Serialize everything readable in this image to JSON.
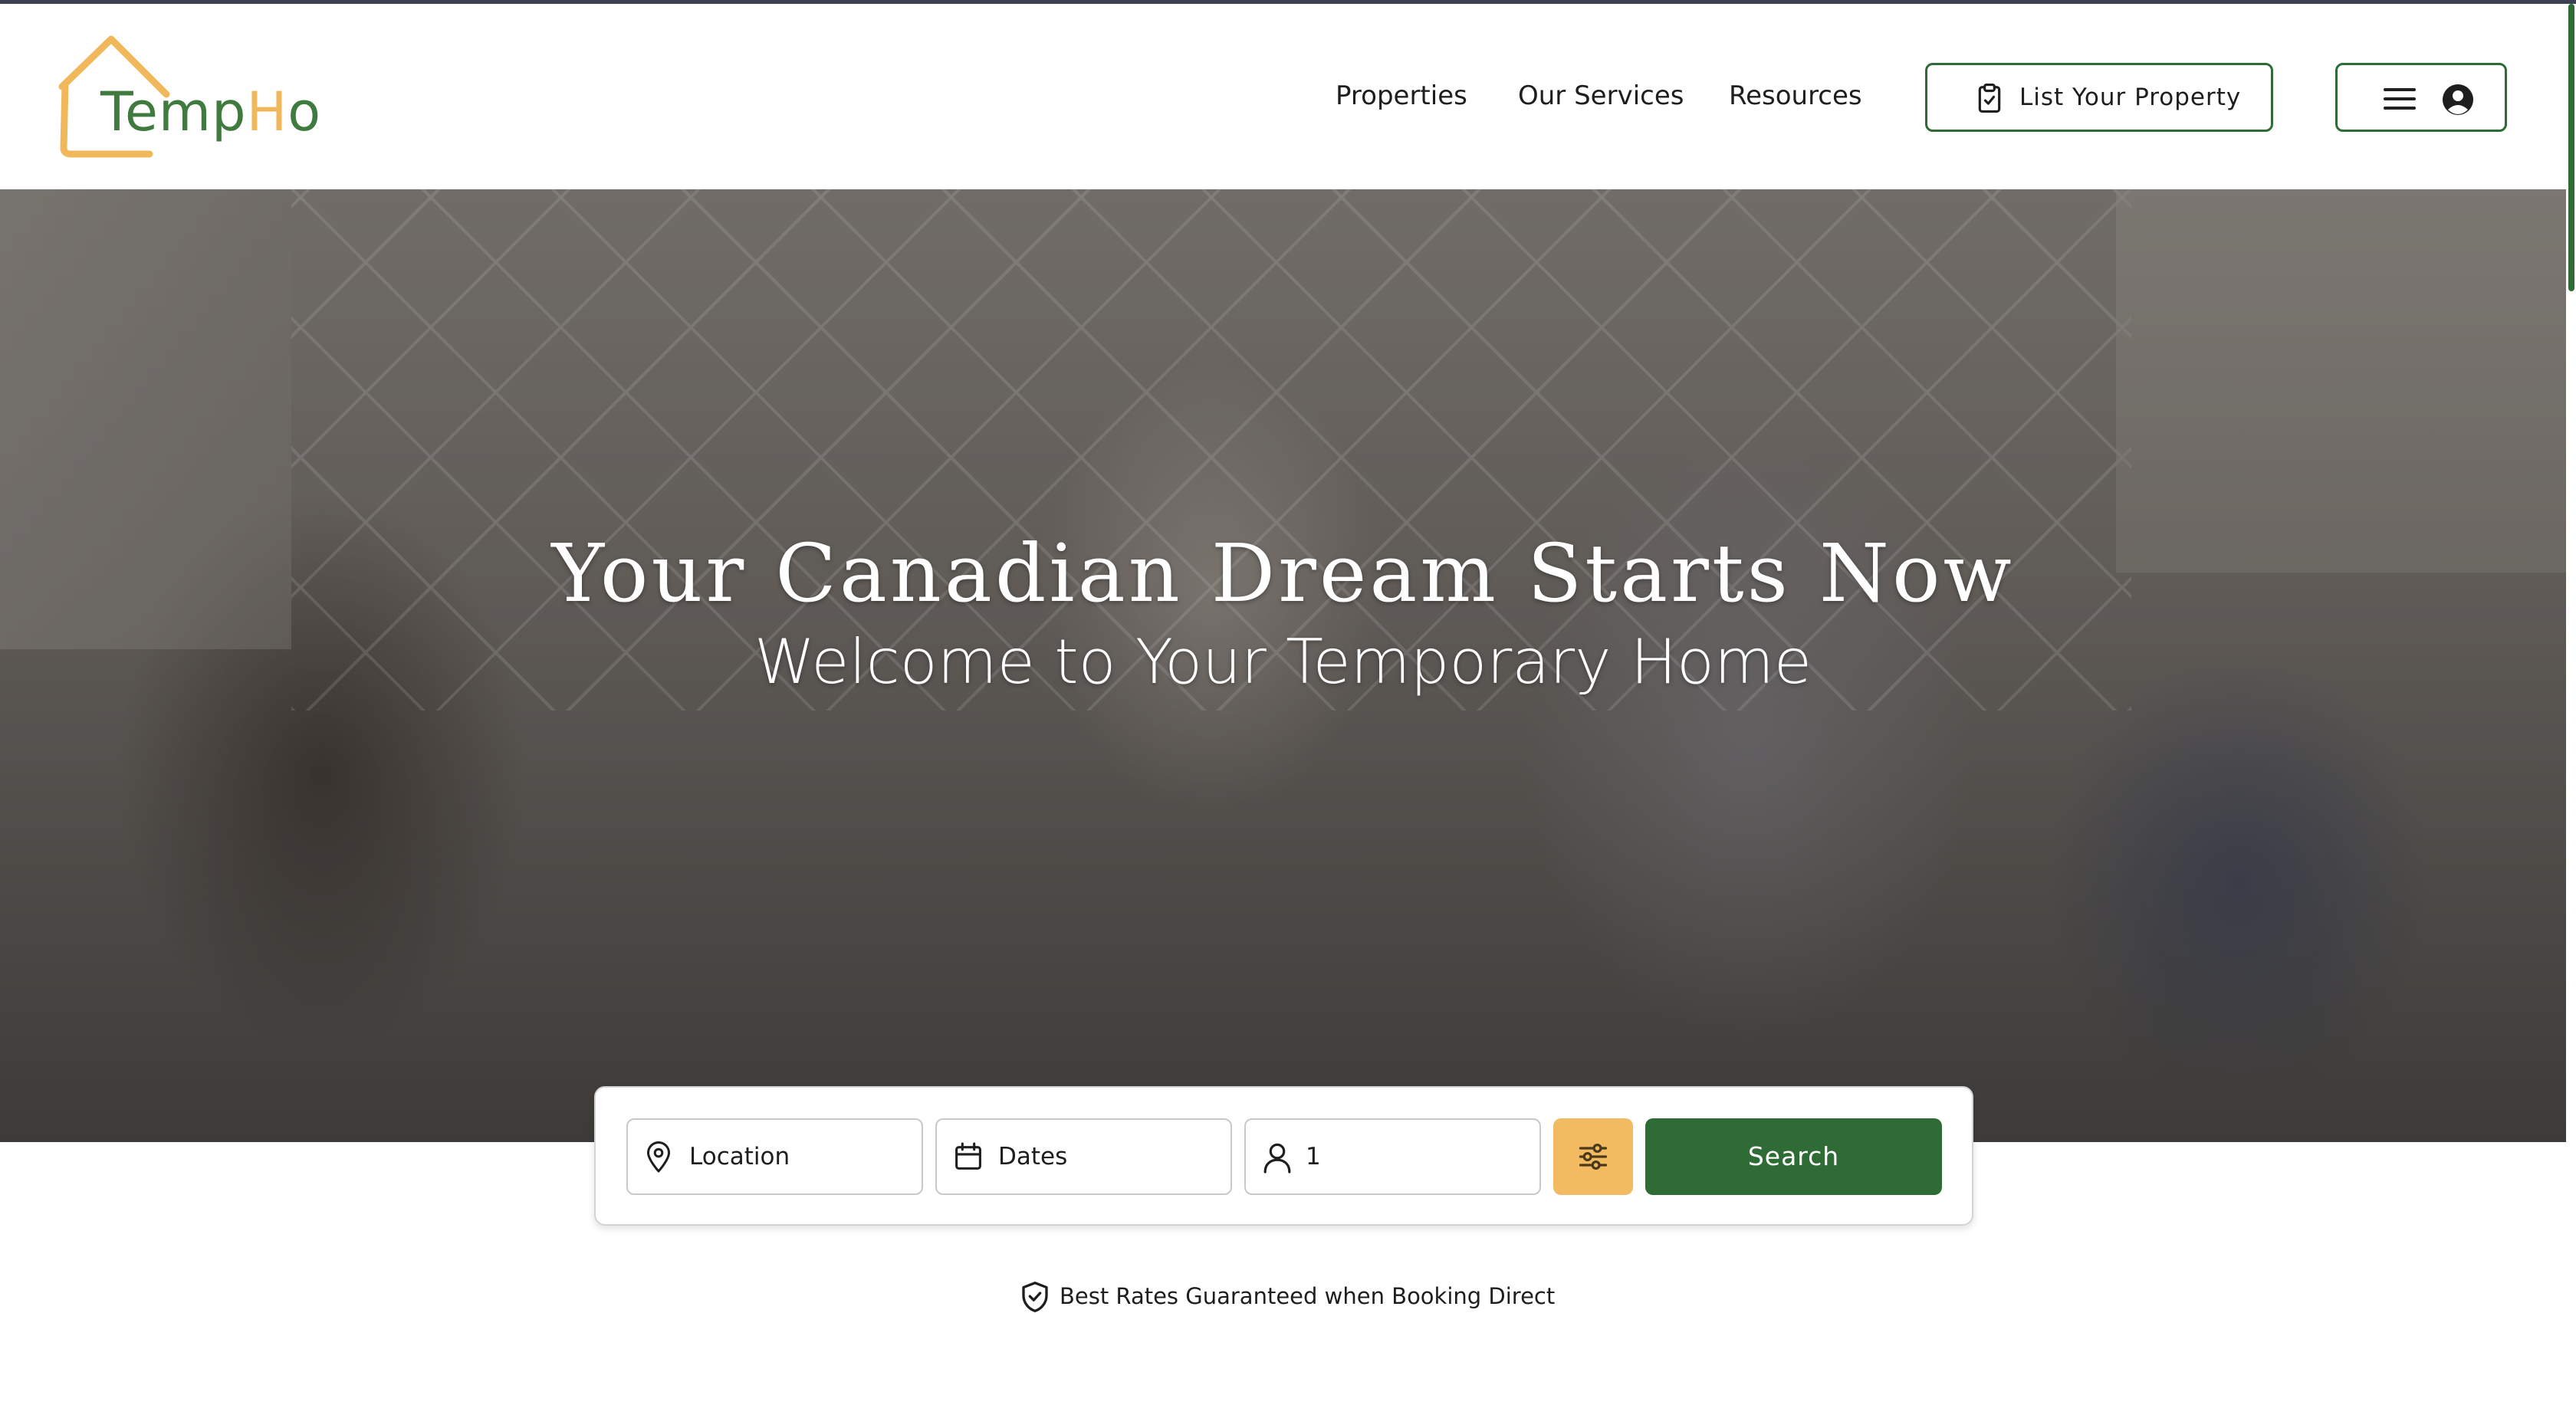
{
  "brand": {
    "name_part1": "Temp",
    "name_part2": "H",
    "name_part3": "o",
    "primary_color": "#2f6b35",
    "accent_color": "#f0b85a"
  },
  "nav": {
    "items": [
      {
        "label": "Properties"
      },
      {
        "label": "Our Services"
      },
      {
        "label": "Resources"
      }
    ],
    "list_property_label": "List Your Property",
    "list_property_icon": "clipboard-check-icon",
    "menu_icon": "hamburger-menu-icon",
    "account_icon": "user-circle-icon"
  },
  "hero": {
    "title": "Your Canadian Dream Starts Now",
    "subtitle": "Welcome to Your Temporary Home"
  },
  "search": {
    "location": {
      "value": "Location",
      "icon": "map-pin-icon"
    },
    "dates": {
      "value": "Dates",
      "icon": "calendar-icon"
    },
    "guests": {
      "value": "1",
      "icon": "user-icon"
    },
    "filter_icon": "sliders-icon",
    "filter_color": "#f2bb62",
    "button_label": "Search"
  },
  "guarantee": {
    "icon": "shield-check-icon",
    "text": "Best Rates Guaranteed when Booking Direct"
  }
}
